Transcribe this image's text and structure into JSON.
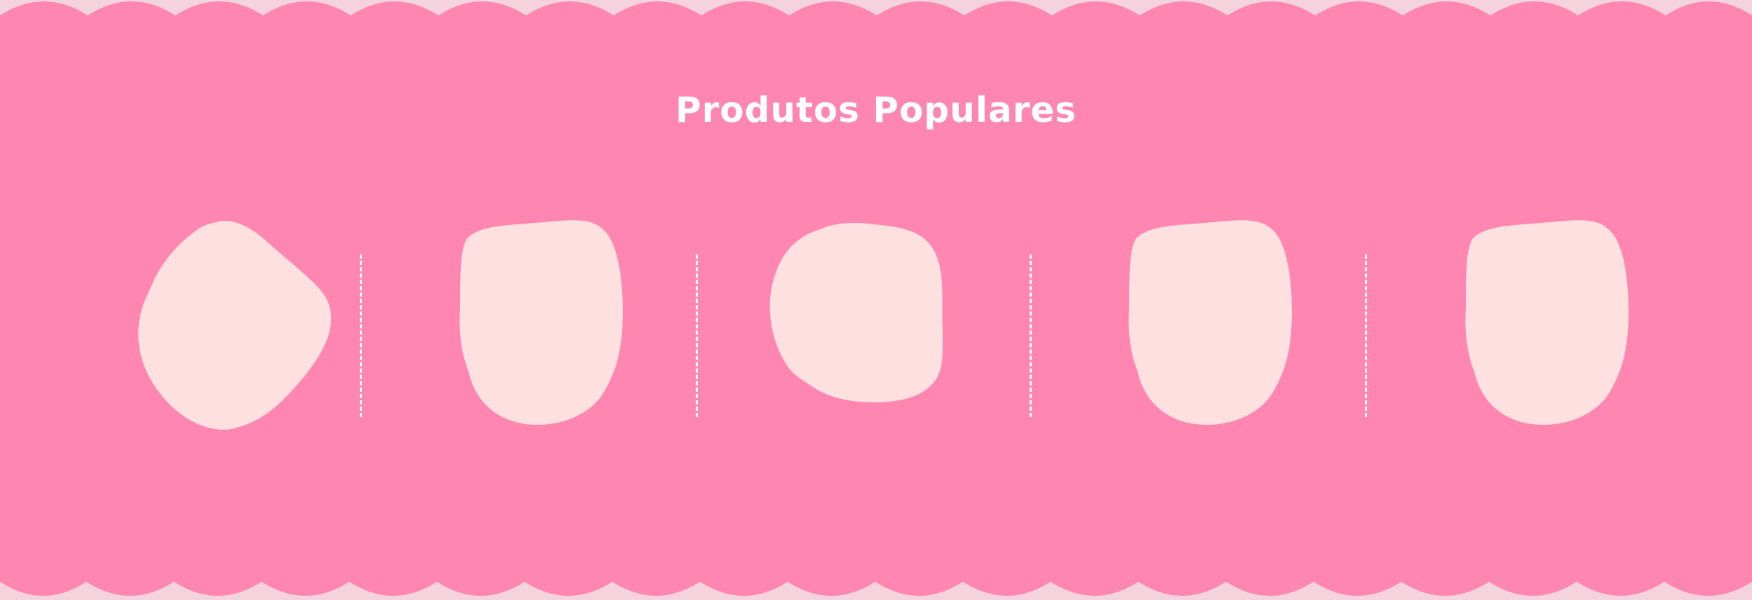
{
  "section": {
    "title": "Produtos Populares",
    "background_color": "#ff86b0",
    "blob_color": "#ffe0e0",
    "page_color": "#f4d3dc"
  },
  "products": [
    {
      "shape": "organic-blob"
    },
    {
      "shape": "rounded-square"
    },
    {
      "shape": "rounded-square"
    },
    {
      "shape": "rounded-square"
    },
    {
      "shape": "rounded-square"
    }
  ]
}
